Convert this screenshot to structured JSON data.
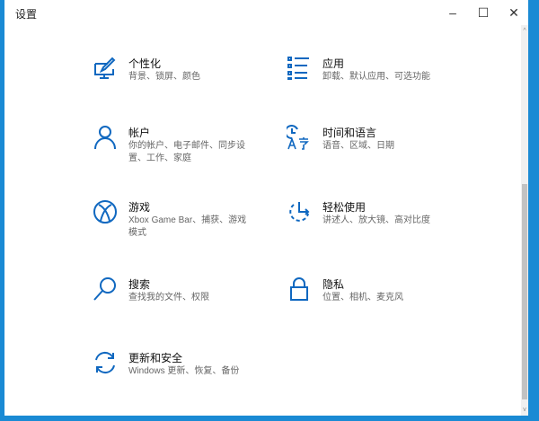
{
  "window": {
    "title": "设置",
    "minimize": "–",
    "maximize": "☐",
    "close": "✕"
  },
  "scrollbar": {
    "up": "^",
    "down": "v",
    "position_percent": 45
  },
  "items": [
    {
      "title": "个性化",
      "desc": "背景、锁屏、颜色",
      "icon": "personalization-icon"
    },
    {
      "title": "应用",
      "desc": "卸载、默认应用、可选功能",
      "icon": "apps-icon"
    },
    {
      "title": "帐户",
      "desc": "你的帐户、电子邮件、同步设置、工作、家庭",
      "icon": "account-icon"
    },
    {
      "title": "时间和语言",
      "desc": "语音、区域、日期",
      "icon": "time-language-icon"
    },
    {
      "title": "游戏",
      "desc": "Xbox Game Bar、捕获、游戏模式",
      "icon": "xbox-icon"
    },
    {
      "title": "轻松使用",
      "desc": "讲述人、放大镜、高对比度",
      "icon": "ease-of-access-icon"
    },
    {
      "title": "搜索",
      "desc": "查找我的文件、权限",
      "icon": "search-icon"
    },
    {
      "title": "隐私",
      "desc": "位置、相机、麦克风",
      "icon": "lock-icon"
    },
    {
      "title": "更新和安全",
      "desc": "Windows 更新、恢复、备份",
      "icon": "update-icon"
    }
  ]
}
